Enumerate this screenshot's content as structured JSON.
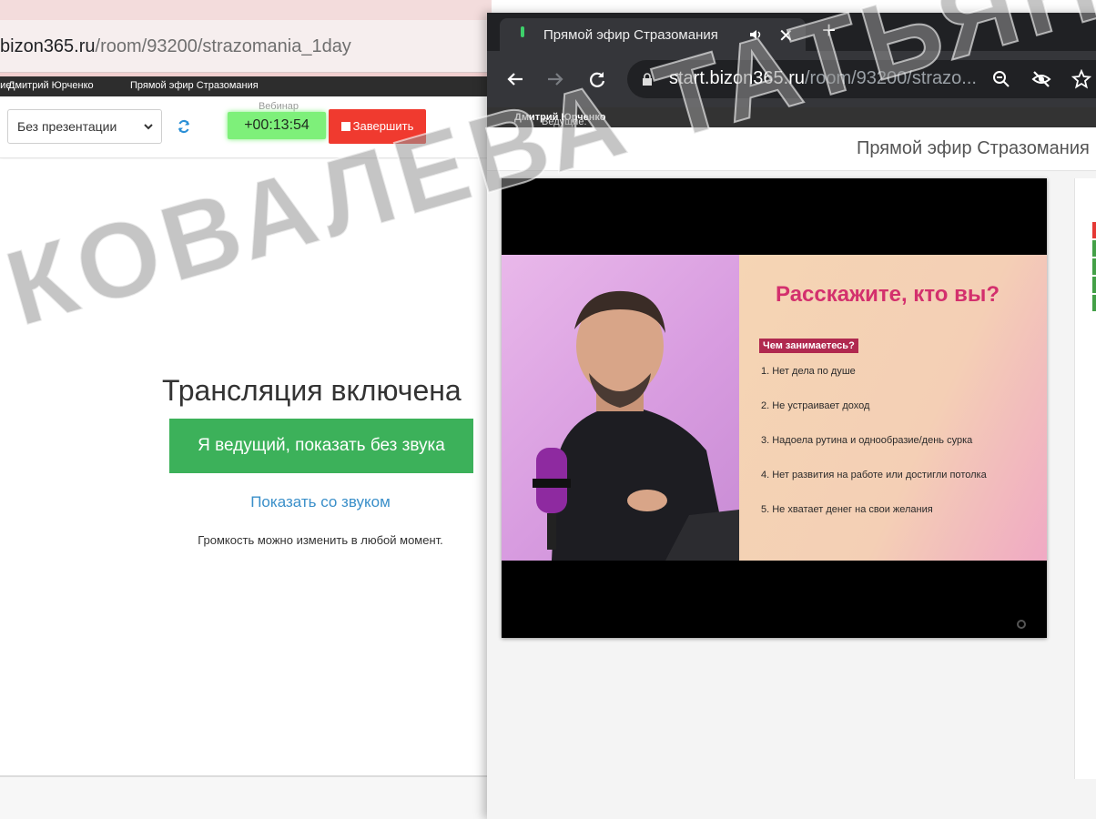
{
  "left_window": {
    "url_main": "bizon365.ru",
    "url_path": "/room/93200/strazomania_1day",
    "host_label": "Ведущие:",
    "host_name": "Дмитрий Юрченко",
    "webinar_name": "Прямой эфир Стразомания",
    "presentation_select": "Без презентации",
    "timer_label": "Вебинар",
    "timer": "+00:13:54",
    "finish_label": "Завершить",
    "broadcast_status": "Трансляция включена",
    "host_button": "Я ведущий, показать без звука",
    "sound_link": "Показать со звуком",
    "volume_hint": "Громкость можно изменить в любой момент."
  },
  "right_window": {
    "tab_title": "Прямой эфир Стразомания",
    "url_main": "start.bizon365.ru",
    "url_path": "/room/93200/strazo...",
    "host_label": "Ведущие:",
    "host_name": "Дмитрий Юрченко",
    "webinar_title": "Прямой эфир Стразомания"
  },
  "slide": {
    "title": "Расскажите, кто вы?",
    "question": "Чем занимаетесь?",
    "items": [
      "1. Нет дела по душе",
      "2. Не устраивает доход",
      "3. Надоела рутина и однообразие/день сурка",
      "4. Нет развития на работе или достигли потолка",
      "5. Не хватает денег на свои желания"
    ]
  },
  "watermark": "КОВАЛЕВА ТАТЬЯНА",
  "colors": {
    "accent_green": "#3cb15a",
    "timer_green": "#7ef07a",
    "finish_red": "#f03a2f",
    "link_blue": "#3a8fc9",
    "slide_pink": "#d3306d"
  }
}
